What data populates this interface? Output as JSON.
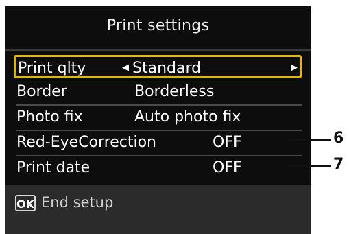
{
  "title": "Print settings",
  "rows": [
    {
      "label": "Print qlty",
      "value": "Standard",
      "left_arrow": "◀",
      "right_arrow": "▶"
    },
    {
      "label": "Border",
      "value": "Borderless"
    },
    {
      "label": "Photo fix",
      "value": "Auto photo fix"
    },
    {
      "label": "Red-EyeCorrection",
      "value": "OFF"
    },
    {
      "label": "Print date",
      "value": "OFF"
    }
  ],
  "footer": {
    "ok_label": "OK",
    "text": "End setup"
  },
  "callouts": [
    {
      "number": "6"
    },
    {
      "number": "7"
    }
  ],
  "colors": {
    "screen_bg": "#0d0d0d",
    "highlight": "#e3b600",
    "footer_bg": "#2b2b2b"
  }
}
